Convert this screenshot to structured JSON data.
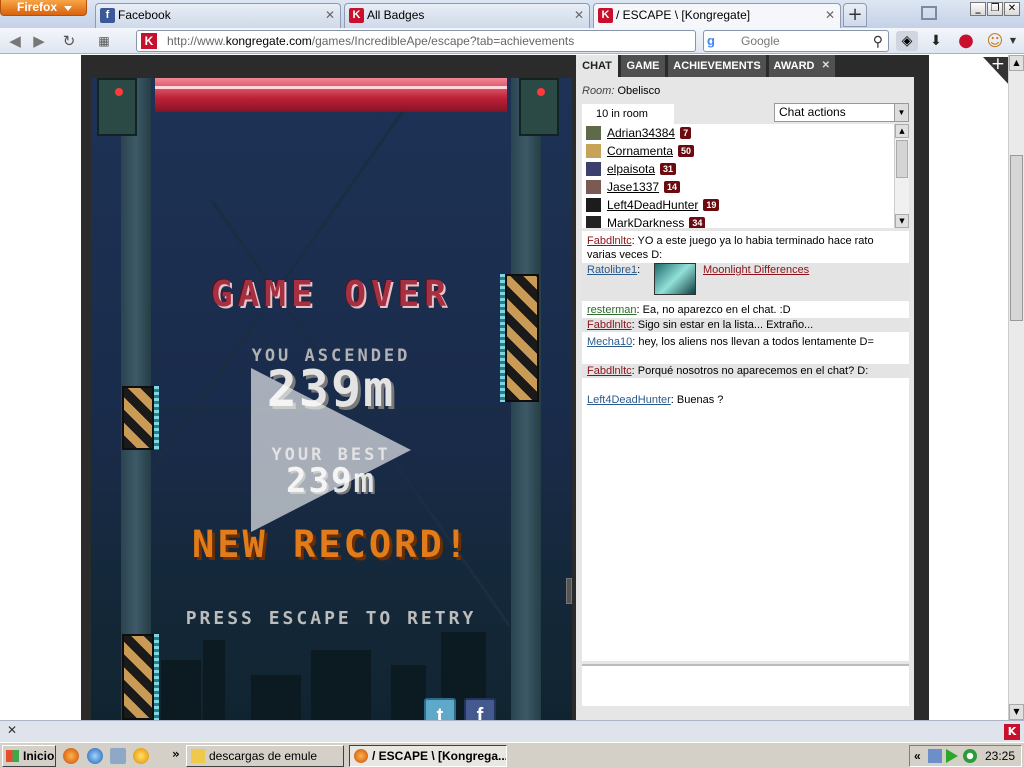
{
  "browser": {
    "menu_button": "Firefox",
    "tabs": [
      {
        "title": "Facebook",
        "icon": "facebook-icon",
        "active": false
      },
      {
        "title": "All Badges",
        "icon": "kongregate-icon",
        "active": false
      },
      {
        "title": "/ ESCAPE \\ [Kongregate]",
        "icon": "kongregate-icon",
        "active": true
      }
    ],
    "favicon_letter": "K",
    "url_prefix": "http://www.",
    "url_domain": "kongregate.com",
    "url_path": "/games/IncredibleApe/escape?tab=achievements",
    "search_placeholder": "Google",
    "search_engine_letter": "g"
  },
  "game": {
    "game_over": "GAME OVER",
    "ascended_label": "YOU ASCENDED",
    "ascended_value": "239m",
    "best_label": "YOUR BEST",
    "best_value": "239m",
    "new_record": "NEW RECORD!",
    "retry_prompt": "PRESS ESCAPE TO RETRY",
    "share_twitter": "t",
    "share_facebook": "f"
  },
  "sidebar": {
    "tabs": [
      {
        "label": "CHAT",
        "active": true
      },
      {
        "label": "GAME",
        "active": false
      },
      {
        "label": "ACHIEVEMENTS",
        "active": false
      },
      {
        "label": "AWARD",
        "active": false
      }
    ],
    "room_label": "Room:",
    "room_name": "Obelisco",
    "in_room": "10 in room",
    "chat_actions": "Chat actions",
    "users": [
      {
        "name": "Adrian34384",
        "level": "7"
      },
      {
        "name": "Cornamenta",
        "level": "50"
      },
      {
        "name": "elpaisota",
        "level": "31"
      },
      {
        "name": "Jase1337",
        "level": "14"
      },
      {
        "name": "Left4DeadHunter",
        "level": "19"
      },
      {
        "name": "MarkDarkness",
        "level": "34"
      }
    ],
    "messages": [
      {
        "user": "Fabdlnltc",
        "text": ": YO a este juego ya lo habia terminado hace rato varias veces D:"
      },
      {
        "user": "Ratolibre1",
        "text": ":",
        "link": "Moonlight Differences"
      },
      {
        "user": "resterman",
        "text": ": Ea, no aparezco en el chat. :D"
      },
      {
        "user": "Fabdlnltc",
        "text": ": Sigo sin estar en la lista... Extraño..."
      },
      {
        "user": "Mecha10",
        "text": ": hey, los aliens nos llevan a todos lentamente D="
      },
      {
        "user": "Fabdlnltc",
        "text": ": Porqué nosotros no aparecemos en el chat? D:"
      },
      {
        "user": "Left4DeadHunter",
        "text": ": Buenas ?"
      }
    ]
  },
  "taskbar": {
    "start_label": "Inicio",
    "overflow": "»",
    "items": [
      {
        "label": "descargas de emule",
        "active": false
      },
      {
        "label": "/ ESCAPE \\ [Kongrega...",
        "active": true
      }
    ],
    "tray_overflow": "«",
    "clock": "23:25"
  },
  "colors": {
    "accent_red": "#8d1119",
    "level_badge": "#6b0b10",
    "firefox_orange": "#e07a1f"
  }
}
